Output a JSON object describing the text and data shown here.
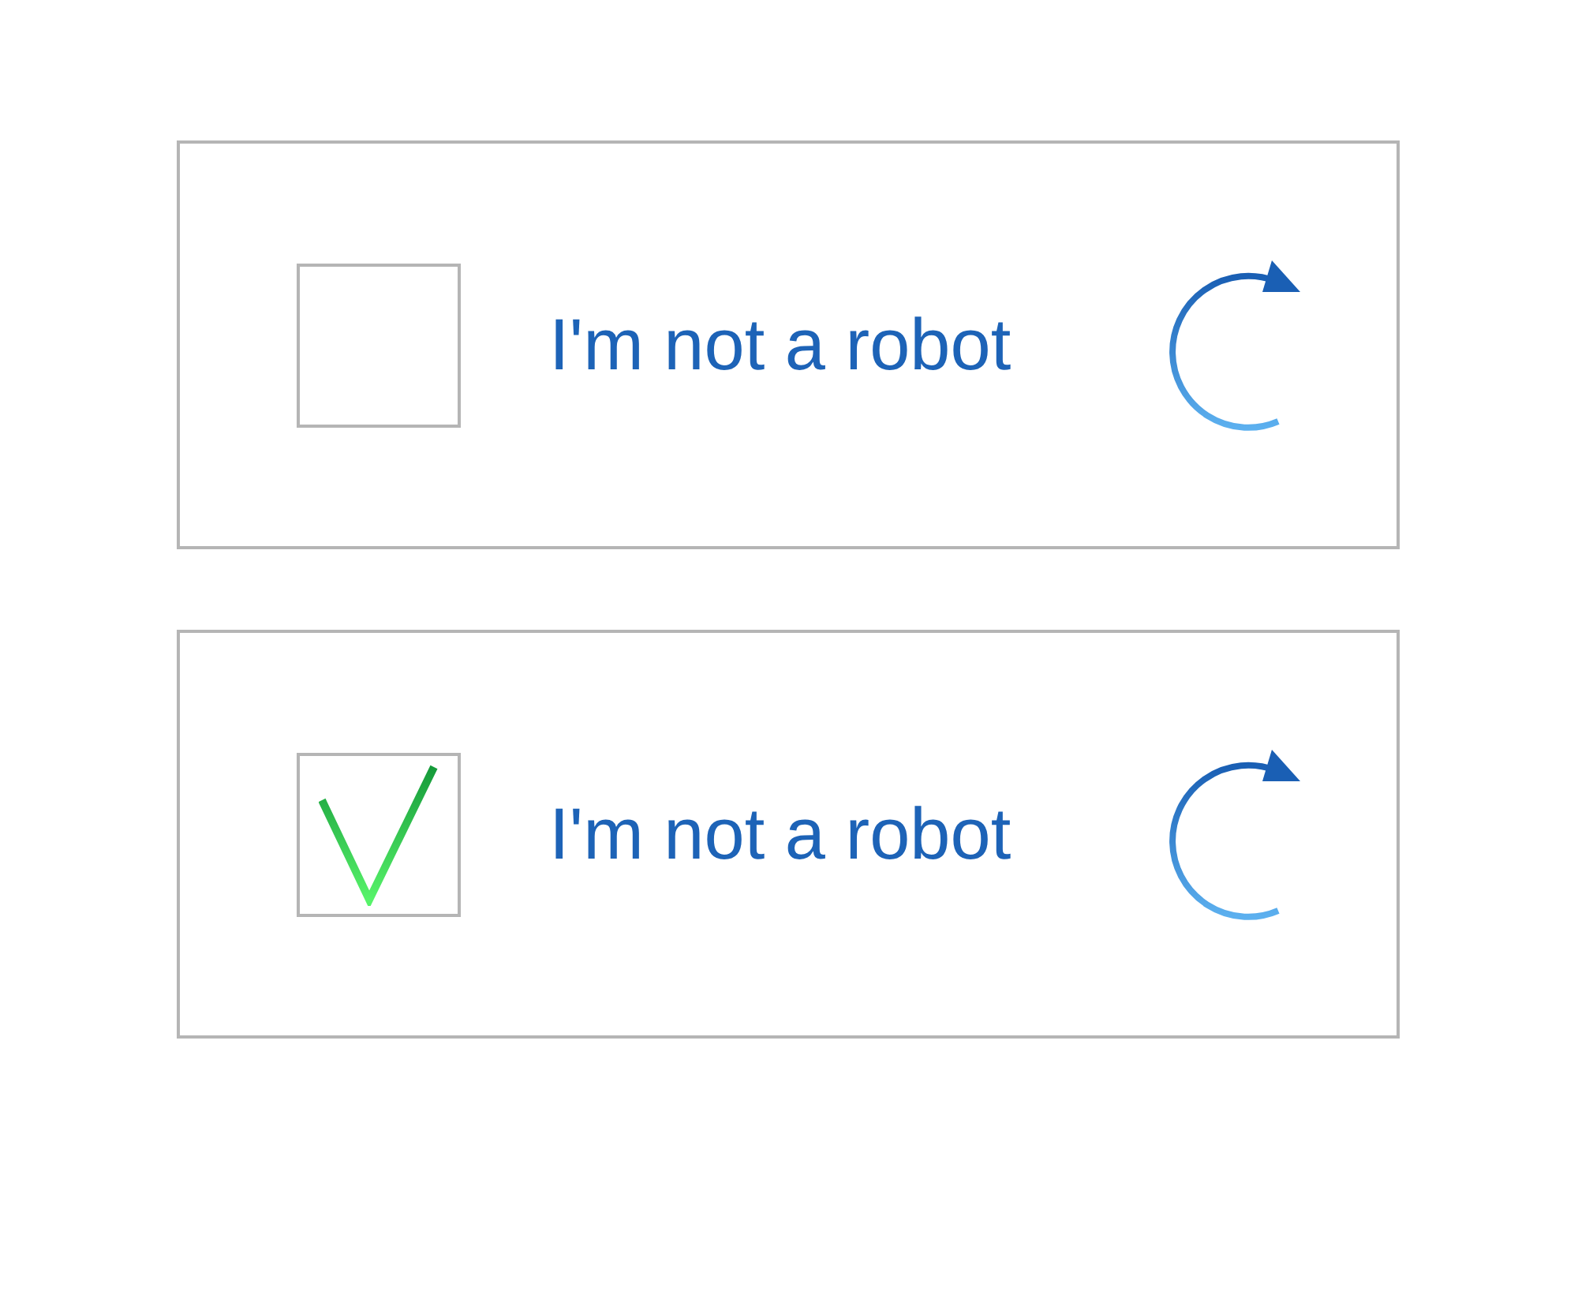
{
  "captchas": [
    {
      "label": "I'm not a robot",
      "checked": false
    },
    {
      "label": "I'm not a robot",
      "checked": true
    }
  ]
}
